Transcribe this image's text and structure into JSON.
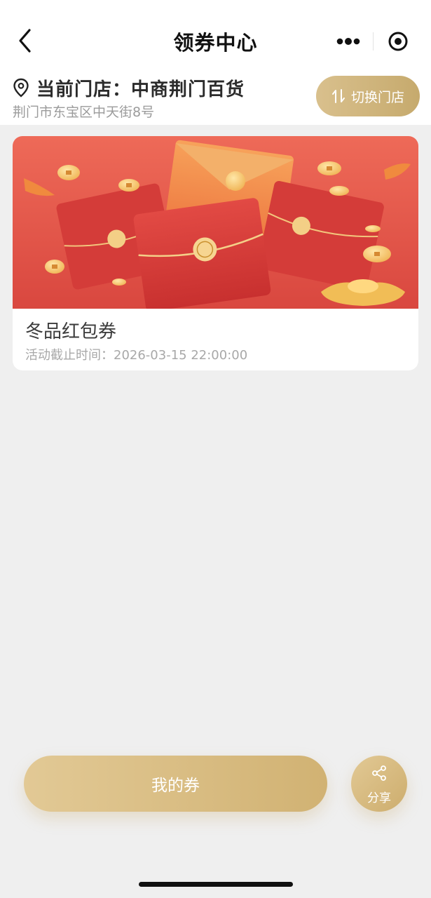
{
  "nav": {
    "title": "领券中心",
    "icons": {
      "back": "chevron-left-icon",
      "more": "more-dots-icon",
      "close": "target-close-icon"
    }
  },
  "store": {
    "label": "当前门店：中商荆门百货",
    "address": "荆门市东宝区中天街8号",
    "switch_label": "切换门店",
    "icons": {
      "location": "location-pin-icon",
      "switch": "swap-arrows-icon"
    }
  },
  "coupons": [
    {
      "title": "冬品红包券",
      "deadline": "活动截止时间：2026-03-15 22:00:00",
      "image": "red-envelope-banner"
    }
  ],
  "bottom": {
    "my_coupons_label": "我的券",
    "share_label": "分享",
    "share_icon": "share-icon"
  },
  "colors": {
    "accent_gold": "#d1b273",
    "banner_red": "#e2584d",
    "background": "#efefef"
  }
}
